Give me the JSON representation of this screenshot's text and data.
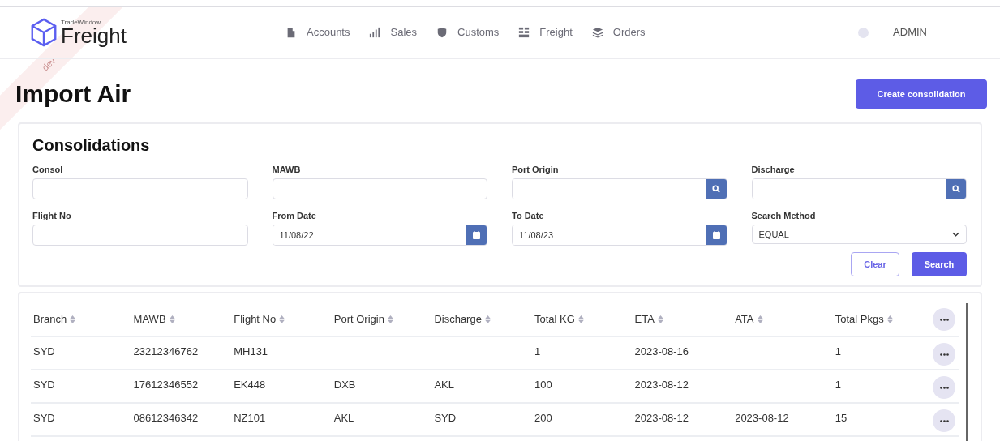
{
  "environment_ribbon": "dev",
  "logo": {
    "tagline": "TradeWindow",
    "name": "Freight"
  },
  "nav": [
    {
      "label": "Accounts"
    },
    {
      "label": "Sales"
    },
    {
      "label": "Customs"
    },
    {
      "label": "Freight"
    },
    {
      "label": "Orders"
    }
  ],
  "user": "ADMIN",
  "page_title": "Import Air",
  "create_button": "Create consolidation",
  "filters": {
    "title": "Consolidations",
    "fields": [
      {
        "label": "Consol",
        "kind": "text"
      },
      {
        "label": "MAWB",
        "kind": "text"
      },
      {
        "label": "Port Origin",
        "kind": "lookup"
      },
      {
        "label": "Discharge",
        "kind": "lookup"
      },
      {
        "label": "Flight No",
        "kind": "text"
      },
      {
        "label": "From Date",
        "kind": "date",
        "value": "11/08/22"
      },
      {
        "label": "To Date",
        "kind": "date",
        "value": "11/08/23"
      },
      {
        "label": "Search Method",
        "kind": "select",
        "value": "EQUAL"
      }
    ],
    "buttons": [
      "Clear",
      "Search"
    ]
  },
  "table": {
    "columns": [
      "Branch",
      "MAWB",
      "Flight No",
      "Port Origin",
      "Discharge",
      "Total KG",
      "ETA",
      "ATA",
      "Total Pkgs"
    ],
    "rows": [
      [
        "SYD",
        "23212346762",
        "MH131",
        "",
        "",
        "1",
        "2023-08-16",
        "",
        "1"
      ],
      [
        "SYD",
        "17612346552",
        "EK448",
        "DXB",
        "AKL",
        "100",
        "2023-08-12",
        "",
        "1"
      ],
      [
        "SYD",
        "08612346342",
        "NZ101",
        "AKL",
        "SYD",
        "200",
        "2023-08-12",
        "2023-08-12",
        "15"
      ]
    ]
  }
}
